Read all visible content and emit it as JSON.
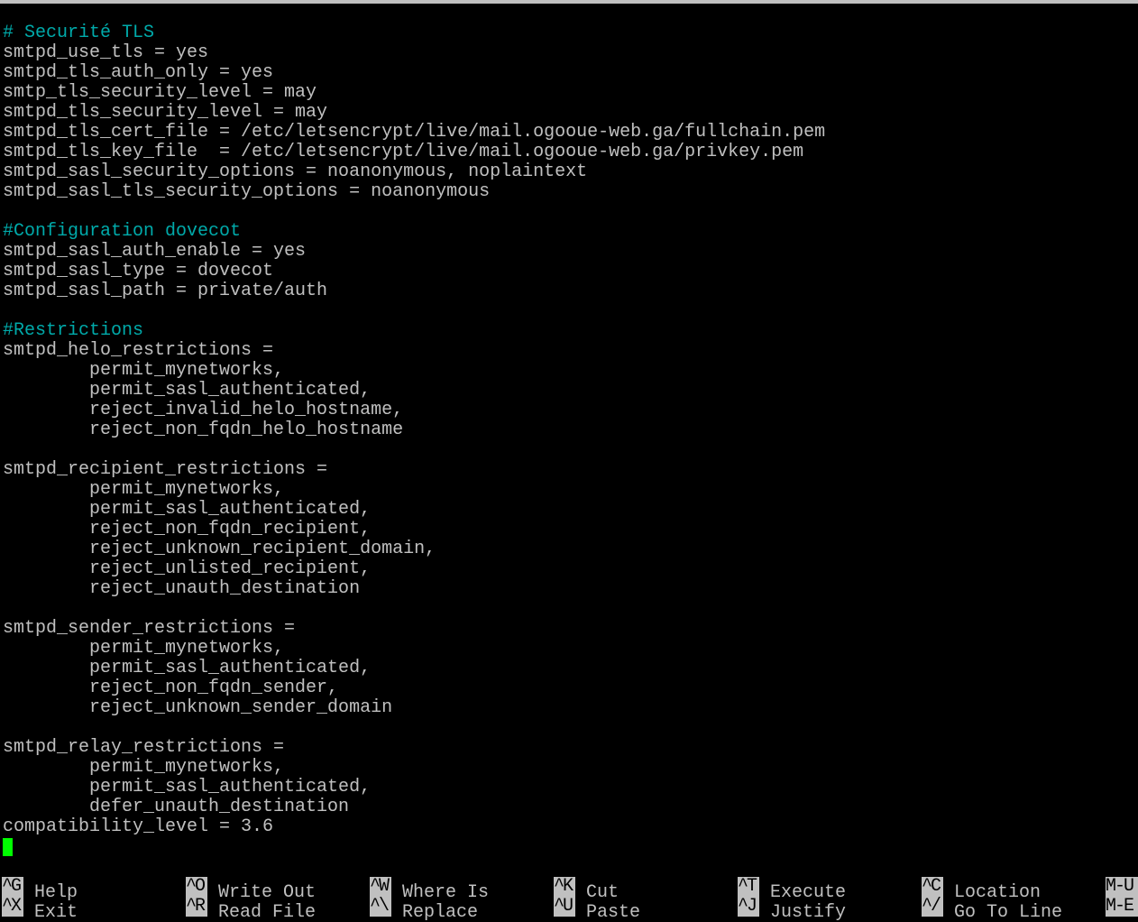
{
  "window": {
    "title_bar_text": ""
  },
  "colors": {
    "background": "#000000",
    "text": "#c0c0c0",
    "comment": "#00aaaa",
    "cursor": "#00ff00",
    "key_bg": "#c0c0c0"
  },
  "editor": {
    "lines": [
      {
        "text": "# Securité TLS",
        "type": "comment"
      },
      {
        "text": "smtpd_use_tls = yes",
        "type": "code"
      },
      {
        "text": "smtpd_tls_auth_only = yes",
        "type": "code"
      },
      {
        "text": "smtp_tls_security_level = may",
        "type": "code"
      },
      {
        "text": "smtpd_tls_security_level = may",
        "type": "code"
      },
      {
        "text": "smtpd_tls_cert_file = /etc/letsencrypt/live/mail.ogooue-web.ga/fullchain.pem",
        "type": "code"
      },
      {
        "text": "smtpd_tls_key_file  = /etc/letsencrypt/live/mail.ogooue-web.ga/privkey.pem",
        "type": "code"
      },
      {
        "text": "smtpd_sasl_security_options = noanonymous, noplaintext",
        "type": "code"
      },
      {
        "text": "smtpd_sasl_tls_security_options = noanonymous",
        "type": "code"
      },
      {
        "text": "",
        "type": "code"
      },
      {
        "text": "#Configuration dovecot",
        "type": "comment"
      },
      {
        "text": "smtpd_sasl_auth_enable = yes",
        "type": "code"
      },
      {
        "text": "smtpd_sasl_type = dovecot",
        "type": "code"
      },
      {
        "text": "smtpd_sasl_path = private/auth",
        "type": "code"
      },
      {
        "text": "",
        "type": "code"
      },
      {
        "text": "#Restrictions",
        "type": "comment"
      },
      {
        "text": "smtpd_helo_restrictions =",
        "type": "code"
      },
      {
        "text": "        permit_mynetworks,",
        "type": "code"
      },
      {
        "text": "        permit_sasl_authenticated,",
        "type": "code"
      },
      {
        "text": "        reject_invalid_helo_hostname,",
        "type": "code"
      },
      {
        "text": "        reject_non_fqdn_helo_hostname",
        "type": "code"
      },
      {
        "text": "",
        "type": "code"
      },
      {
        "text": "smtpd_recipient_restrictions =",
        "type": "code"
      },
      {
        "text": "        permit_mynetworks,",
        "type": "code"
      },
      {
        "text": "        permit_sasl_authenticated,",
        "type": "code"
      },
      {
        "text": "        reject_non_fqdn_recipient,",
        "type": "code"
      },
      {
        "text": "        reject_unknown_recipient_domain,",
        "type": "code"
      },
      {
        "text": "        reject_unlisted_recipient,",
        "type": "code"
      },
      {
        "text": "        reject_unauth_destination",
        "type": "code"
      },
      {
        "text": "",
        "type": "code"
      },
      {
        "text": "smtpd_sender_restrictions =",
        "type": "code"
      },
      {
        "text": "        permit_mynetworks,",
        "type": "code"
      },
      {
        "text": "        permit_sasl_authenticated,",
        "type": "code"
      },
      {
        "text": "        reject_non_fqdn_sender,",
        "type": "code"
      },
      {
        "text": "        reject_unknown_sender_domain",
        "type": "code"
      },
      {
        "text": "",
        "type": "code"
      },
      {
        "text": "smtpd_relay_restrictions =",
        "type": "code"
      },
      {
        "text": "        permit_mynetworks,",
        "type": "code"
      },
      {
        "text": "        permit_sasl_authenticated,",
        "type": "code"
      },
      {
        "text": "        defer_unauth_destination",
        "type": "code"
      },
      {
        "text": "compatibility_level = 3.6",
        "type": "code"
      },
      {
        "text": "",
        "type": "cursor"
      }
    ]
  },
  "shortcuts": {
    "row1": [
      {
        "key": "^G",
        "label": "Help"
      },
      {
        "key": "^O",
        "label": "Write Out"
      },
      {
        "key": "^W",
        "label": "Where Is"
      },
      {
        "key": "^K",
        "label": "Cut"
      },
      {
        "key": "^T",
        "label": "Execute"
      },
      {
        "key": "^C",
        "label": "Location"
      },
      {
        "key": "M-U",
        "label": ""
      }
    ],
    "row2": [
      {
        "key": "^X",
        "label": "Exit"
      },
      {
        "key": "^R",
        "label": "Read File"
      },
      {
        "key": "^\\",
        "label": "Replace"
      },
      {
        "key": "^U",
        "label": "Paste"
      },
      {
        "key": "^J",
        "label": "Justify"
      },
      {
        "key": "^/",
        "label": "Go To Line"
      },
      {
        "key": "M-E",
        "label": ""
      }
    ]
  }
}
